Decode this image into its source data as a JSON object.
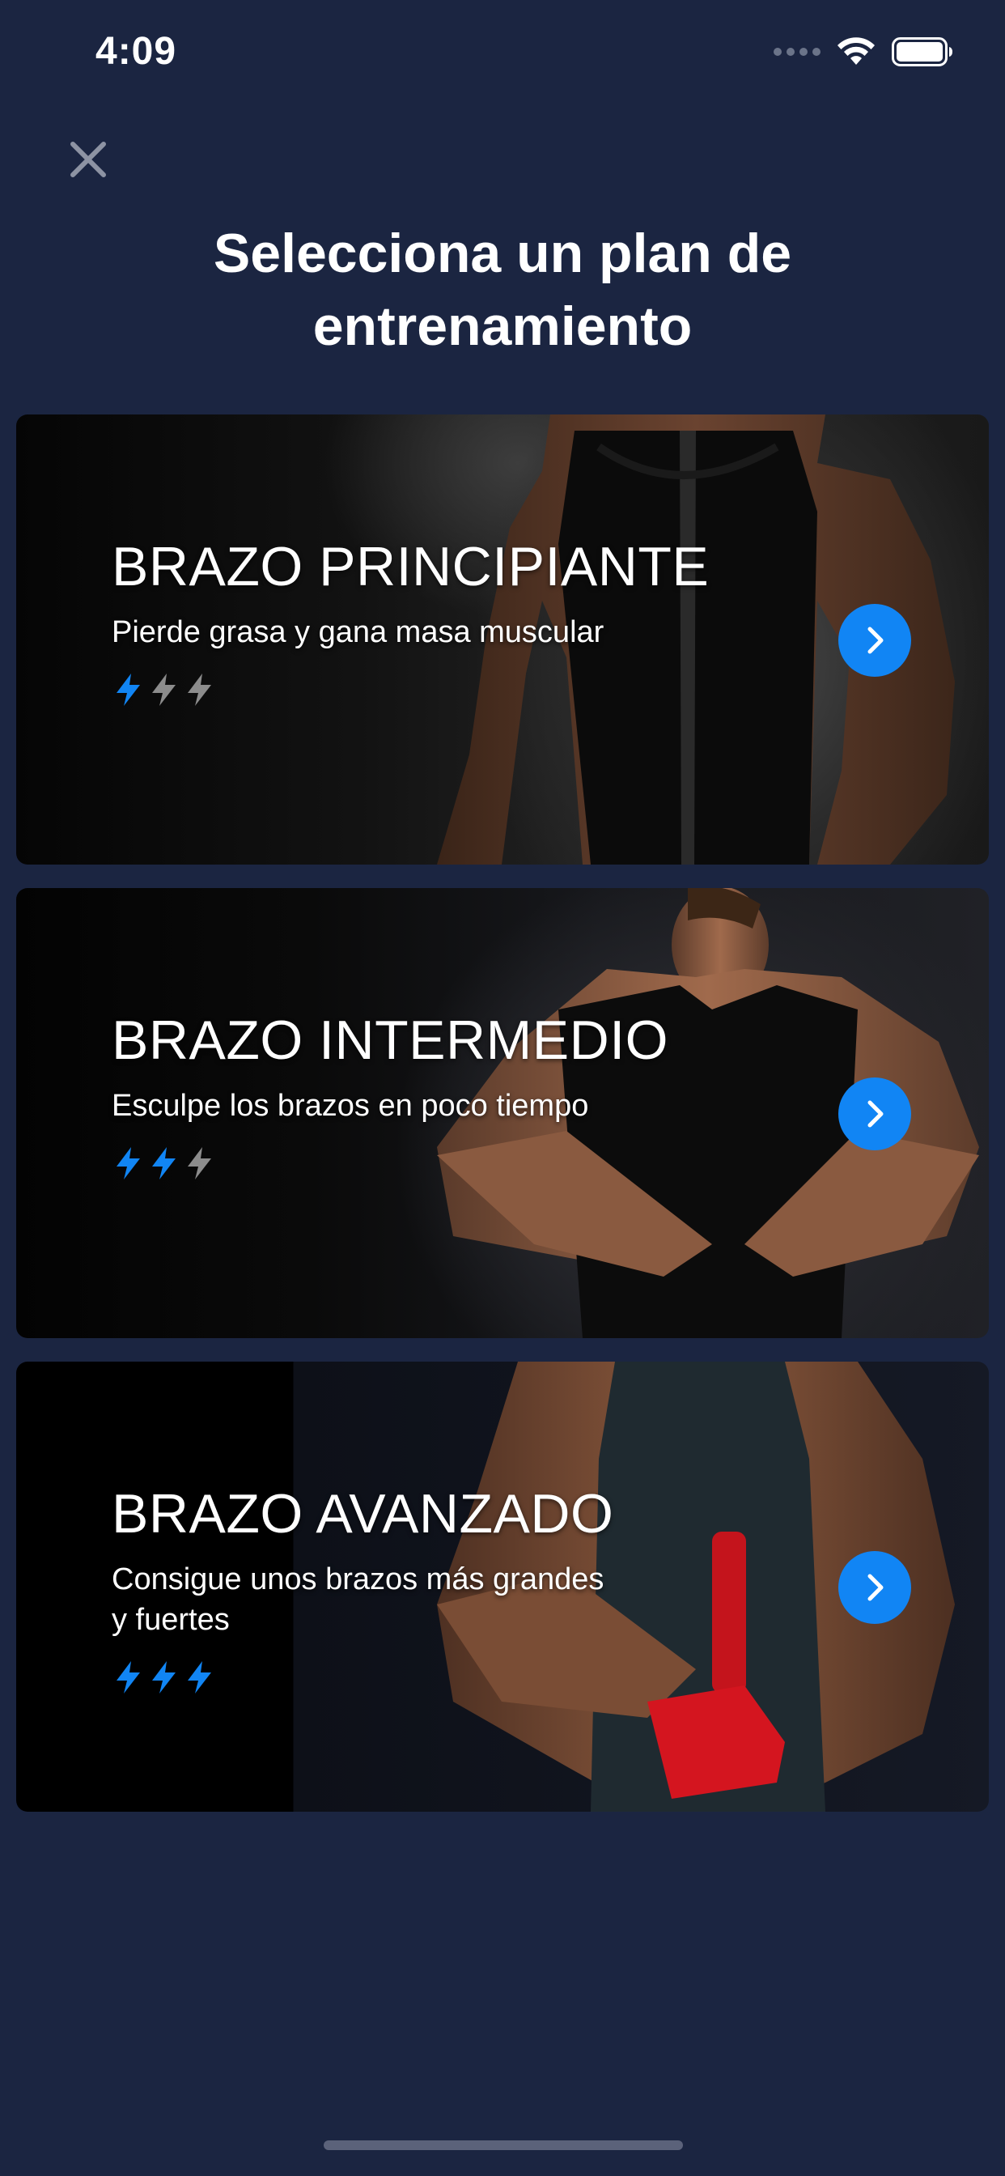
{
  "status_bar": {
    "time": "4:09"
  },
  "header": {
    "title_line1": "Selecciona un plan de",
    "title_line2": "entrenamiento"
  },
  "plans": [
    {
      "title": "BRAZO PRINCIPIANTE",
      "subtitle": "Pierde grasa y gana masa muscular",
      "level": 1,
      "max_level": 3
    },
    {
      "title": "BRAZO INTERMEDIO",
      "subtitle": "Esculpe los brazos en poco tiempo",
      "level": 2,
      "max_level": 3
    },
    {
      "title": "BRAZO AVANZADO",
      "subtitle_line1": "Consigue unos brazos más grandes",
      "subtitle_line2": "y fuertes",
      "level": 3,
      "max_level": 3
    }
  ],
  "colors": {
    "background": "#1b2541",
    "accent": "#1185f4",
    "bolt_active": "#1185f4",
    "bolt_inactive": "#8c8c8c"
  },
  "icons": {
    "close": "close-icon",
    "arrow": "chevron-right-icon",
    "level": "lightning-bolt-icon"
  }
}
